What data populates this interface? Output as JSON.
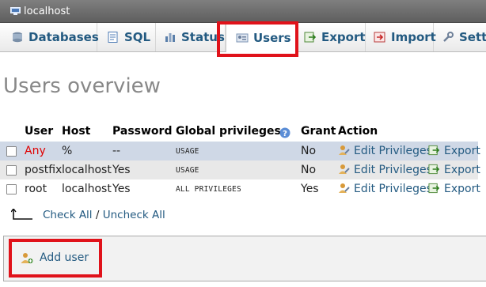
{
  "server": {
    "title": "localhost",
    "icon": "server-icon"
  },
  "tabs": [
    {
      "label": "Databases",
      "icon": "databases-icon"
    },
    {
      "label": "SQL",
      "icon": "sql-icon"
    },
    {
      "label": "Status",
      "icon": "status-icon"
    },
    {
      "label": "Users",
      "icon": "users-icon",
      "active": true
    },
    {
      "label": "Export",
      "icon": "export-icon"
    },
    {
      "label": "Import",
      "icon": "import-icon"
    },
    {
      "label": "Setti",
      "icon": "settings-icon"
    }
  ],
  "page_title": "Users overview",
  "table": {
    "columns": [
      "User",
      "Host",
      "Password",
      "Global privileges",
      "Grant",
      "Action"
    ],
    "rows": [
      {
        "user": "Any",
        "host": "%",
        "password": "--",
        "privileges": "USAGE",
        "grant": "No",
        "edit": "Edit Privileges",
        "export": "Export"
      },
      {
        "user": "postfix",
        "host": "localhost",
        "password": "Yes",
        "privileges": "USAGE",
        "grant": "No",
        "edit": "Edit Privileges",
        "export": "Export"
      },
      {
        "user": "root",
        "host": "localhost",
        "password": "Yes",
        "privileges": "ALL PRIVILEGES",
        "grant": "Yes",
        "edit": "Edit Privileges",
        "export": "Export"
      }
    ]
  },
  "check_all": "Check All",
  "separator": "/",
  "uncheck_all": "Uncheck All",
  "add_user": "Add user",
  "colors": {
    "link": "#235a81",
    "highlight": "#e0121a",
    "selected_row": "#cfd8e6"
  }
}
